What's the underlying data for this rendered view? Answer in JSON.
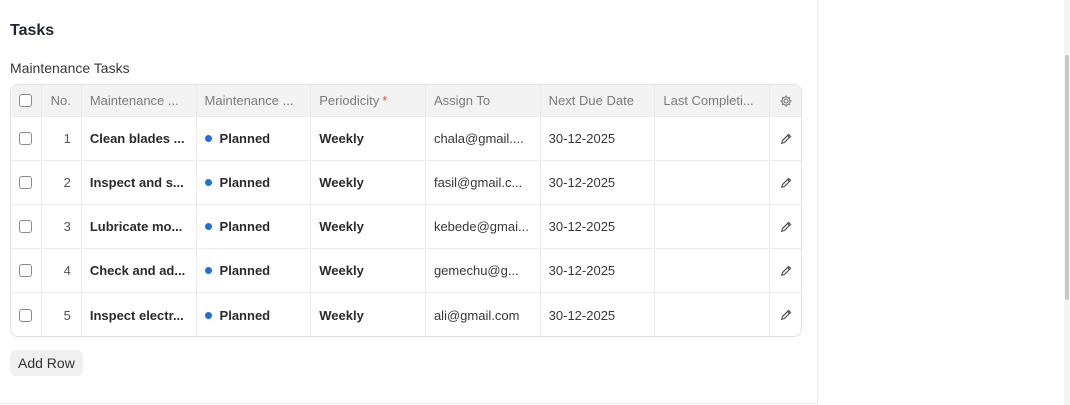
{
  "section": {
    "title": "Tasks"
  },
  "table": {
    "label": "Maintenance Tasks",
    "status_color": "#1f6fdb",
    "headers": {
      "no": "No.",
      "task": "Maintenance ...",
      "status": "Maintenance ...",
      "periodicity": "Periodicity",
      "periodicity_required": "*",
      "assign_to": "Assign To",
      "next_due": "Next Due Date",
      "last_completion": "Last Completi..."
    },
    "rows": [
      {
        "no": "1",
        "task": "Clean blades ...",
        "status": "Planned",
        "periodicity": "Weekly",
        "assign_to": "chala@gmail....",
        "next_due": "30-12-2025",
        "last_completion": ""
      },
      {
        "no": "2",
        "task": "Inspect and s...",
        "status": "Planned",
        "periodicity": "Weekly",
        "assign_to": "fasil@gmail.c...",
        "next_due": "30-12-2025",
        "last_completion": ""
      },
      {
        "no": "3",
        "task": "Lubricate mo...",
        "status": "Planned",
        "periodicity": "Weekly",
        "assign_to": "kebede@gmai...",
        "next_due": "30-12-2025",
        "last_completion": ""
      },
      {
        "no": "4",
        "task": "Check and ad...",
        "status": "Planned",
        "periodicity": "Weekly",
        "assign_to": "gemechu@g...",
        "next_due": "30-12-2025",
        "last_completion": ""
      },
      {
        "no": "5",
        "task": "Inspect electr...",
        "status": "Planned",
        "periodicity": "Weekly",
        "assign_to": "ali@gmail.com",
        "next_due": "30-12-2025",
        "last_completion": ""
      }
    ]
  },
  "actions": {
    "add_row": "Add Row"
  }
}
